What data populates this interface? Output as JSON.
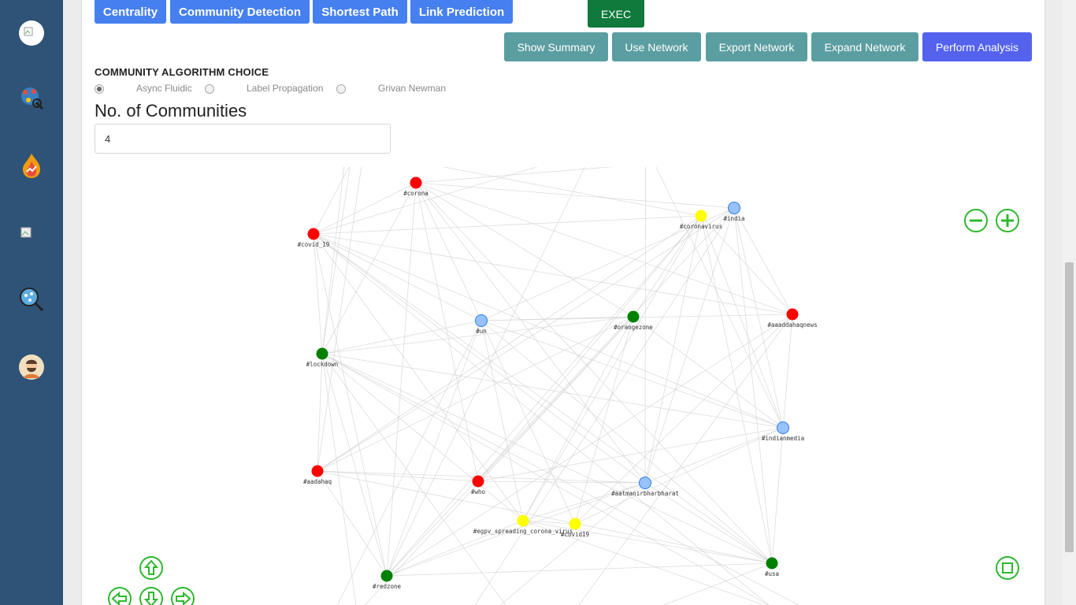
{
  "tabs": [
    "Centrality",
    "Community Detection",
    "Shortest Path",
    "Link Prediction"
  ],
  "exec_label": "EXEC",
  "actions": [
    "Show Summary",
    "Use Network",
    "Export Network",
    "Expand Network",
    "Perform Analysis"
  ],
  "algorithm": {
    "heading": "COMMUNITY ALGORITHM CHOICE",
    "options": [
      "Async Fluidic",
      "Label Propagation",
      "Grivan Newman"
    ],
    "selected": "Async Fluidic"
  },
  "communities": {
    "label": "No. of Communities",
    "value": "4"
  },
  "colors": {
    "red": "#ff0000",
    "green": "#008000",
    "blue": "#97c2fc",
    "yellow": "#ffff00",
    "accent": "#4680f0",
    "nav_control": "#2db82d"
  },
  "graph": {
    "nodes": [
      {
        "id": "#corona",
        "color": "red"
      },
      {
        "id": "#covid_19",
        "color": "red"
      },
      {
        "id": "#coronavirus",
        "color": "yellow"
      },
      {
        "id": "#india",
        "color": "blue"
      },
      {
        "id": "#un",
        "color": "blue"
      },
      {
        "id": "#orangezone",
        "color": "green"
      },
      {
        "id": "#aaaddahaqnews",
        "color": "red"
      },
      {
        "id": "#lockdown",
        "color": "green"
      },
      {
        "id": "#indianmedia",
        "color": "blue"
      },
      {
        "id": "#aadahaq",
        "color": "red"
      },
      {
        "id": "#who",
        "color": "red"
      },
      {
        "id": "#aatmanirbharbharat",
        "color": "blue"
      },
      {
        "id": "#egpv_spreading_corona_virus",
        "color": "yellow"
      },
      {
        "id": "#covid19",
        "color": "yellow"
      },
      {
        "id": "#redzone",
        "color": "green"
      },
      {
        "id": "#usa",
        "color": "green"
      }
    ]
  },
  "nav_controls": [
    "zoom-out",
    "zoom-in",
    "fit",
    "up",
    "left",
    "down",
    "right"
  ]
}
